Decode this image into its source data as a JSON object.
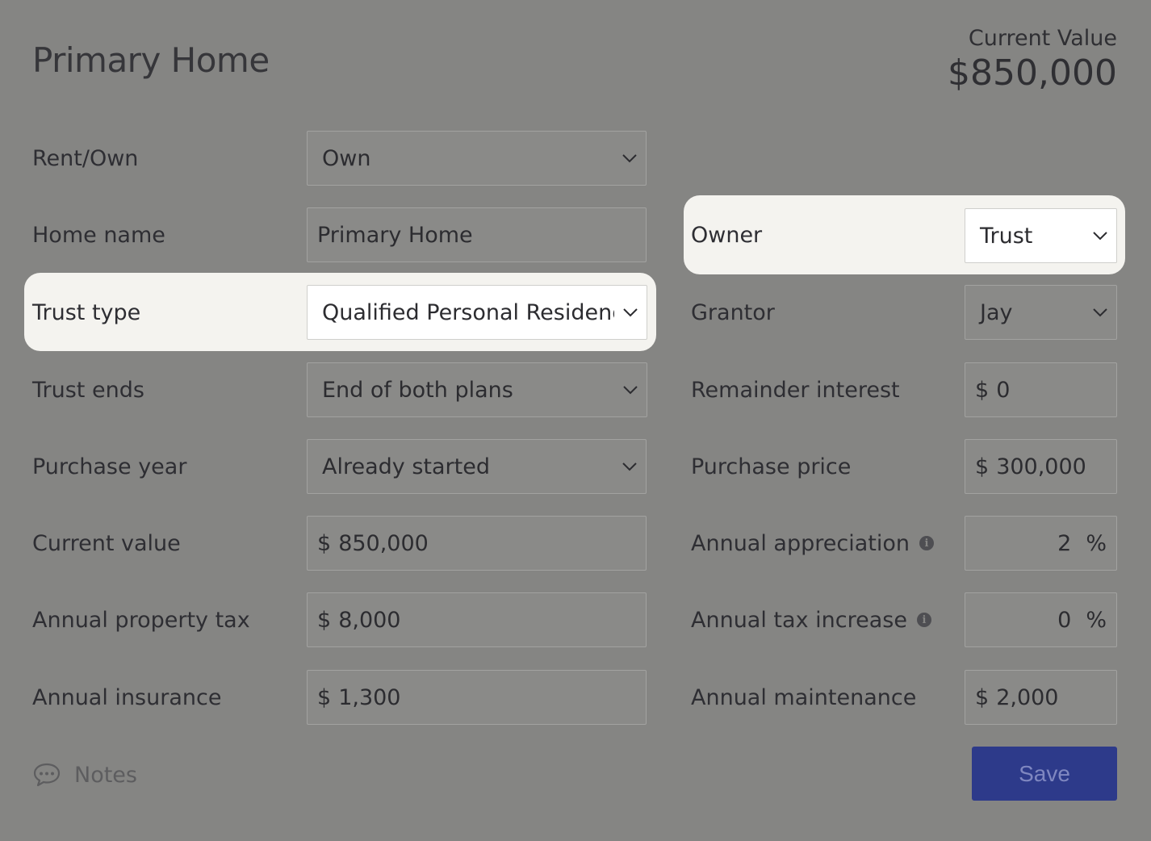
{
  "header": {
    "title": "Primary Home",
    "current_value_label": "Current Value",
    "current_value": "$850,000"
  },
  "left": {
    "rent_own": {
      "label": "Rent/Own",
      "value": "Own"
    },
    "home_name": {
      "label": "Home name",
      "value": "Primary Home"
    },
    "trust_type": {
      "label": "Trust type",
      "value": "Qualified Personal Residence Trust"
    },
    "trust_ends": {
      "label": "Trust ends",
      "value": "End of both plans"
    },
    "purchase_year": {
      "label": "Purchase year",
      "value": "Already started"
    },
    "current_value": {
      "label": "Current value",
      "currency": "$",
      "value": "850,000"
    },
    "property_tax": {
      "label": "Annual property tax",
      "currency": "$",
      "value": "8,000"
    },
    "insurance": {
      "label": "Annual insurance",
      "currency": "$",
      "value": "1,300"
    }
  },
  "right": {
    "owner": {
      "label": "Owner",
      "value": "Trust"
    },
    "grantor": {
      "label": "Grantor",
      "value": "Jay"
    },
    "remainder_interest": {
      "label": "Remainder interest",
      "currency": "$",
      "value": "0"
    },
    "purchase_price": {
      "label": "Purchase price",
      "currency": "$",
      "value": "300,000"
    },
    "appreciation": {
      "label": "Annual appreciation",
      "value": "2",
      "unit": "%"
    },
    "tax_increase": {
      "label": "Annual tax increase",
      "value": "0",
      "unit": "%"
    },
    "maintenance": {
      "label": "Annual maintenance",
      "currency": "$",
      "value": "2,000"
    }
  },
  "footer": {
    "notes_label": "Notes",
    "save_label": "Save"
  },
  "icons": {
    "chevron": "chevron-down-icon",
    "info": "info-icon",
    "notes": "speech-bubble-icon"
  },
  "colors": {
    "overlay_background": "#858583",
    "highlight_background": "#f4f3ef",
    "save_button": "#2d3a8a"
  }
}
